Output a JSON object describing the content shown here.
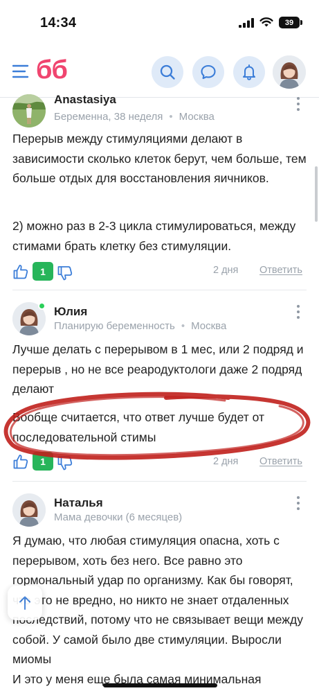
{
  "status_bar": {
    "time": "14:34",
    "battery": "39"
  },
  "header": {
    "logo": "бб",
    "icons": [
      "menu-icon",
      "search-icon",
      "chat-icon",
      "bell-icon",
      "avatar"
    ]
  },
  "comments": [
    {
      "author": "Anastasiya",
      "status": "Беременна, 38 неделя",
      "city": "Москва",
      "paragraphs": [
        "Перерыв между стимуляциями делают в зависимости сколько клеток берут, чем больше, тем больше отдых для восстановления яичников.",
        "2) можно раз в 2-3 цикла стимулироваться, между стимами брать клетку без стимуляции."
      ],
      "likes": "1",
      "date": "2 дня",
      "reply": "Ответить"
    },
    {
      "author": "Юлия",
      "status": "Планирую беременность",
      "city": "Москва",
      "paragraphs": [
        "Лучше делать с перерывом в 1 мес, или 2 подряд и перерыв , но не все реародуктологи даже 2 подряд делают",
        "Вообще считается, что ответ лучше будет от последовательной стимы"
      ],
      "likes": "1",
      "date": "2 дня",
      "reply": "Ответить"
    },
    {
      "author": "Наталья",
      "status": "Мама девочки (6 месяцев)",
      "paragraphs": [
        "Я думаю, что любая стимуляция опасна, хоть с перерывом, хоть без него. Все равно это гормональный удар по организму. Как бы говорят, что это не вредно, но никто не знает отдаленных последствий, потому что не связывает вещи между собой. У самой было две стимуляции. Выросли миомы",
        "И это у меня еще была самая минимальная"
      ]
    }
  ],
  "colors": {
    "brand": "#f0456f",
    "like": "#27b55a",
    "icon_bg": "#dfeaf8",
    "accent_icon": "#3b7dd8",
    "scribble": "#c0201c"
  }
}
